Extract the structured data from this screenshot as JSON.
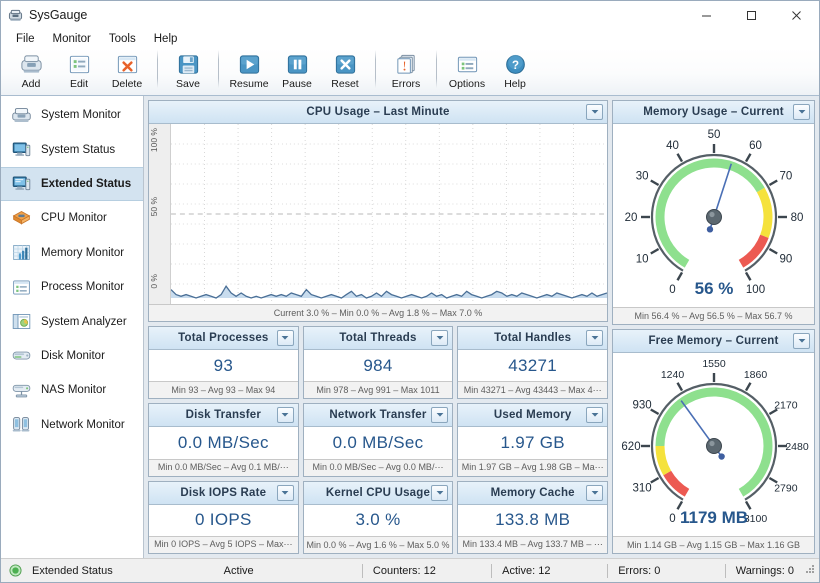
{
  "window": {
    "title": "SysGauge",
    "icon": "sysgauge-icon",
    "controls": {
      "minimize": "–",
      "maximize": "☐",
      "close": "✕"
    }
  },
  "menubar": {
    "items": [
      {
        "label": "File",
        "name": "menu-file"
      },
      {
        "label": "Monitor",
        "name": "menu-monitor"
      },
      {
        "label": "Tools",
        "name": "menu-tools"
      },
      {
        "label": "Help",
        "name": "menu-help"
      }
    ]
  },
  "toolbar": {
    "buttons": [
      {
        "label": "Add",
        "icon": "add-icon"
      },
      {
        "label": "Edit",
        "icon": "edit-icon"
      },
      {
        "label": "Delete",
        "icon": "delete-icon"
      },
      {
        "label": "Save",
        "icon": "save-icon"
      },
      {
        "label": "Resume",
        "icon": "play-icon"
      },
      {
        "label": "Pause",
        "icon": "pause-icon"
      },
      {
        "label": "Reset",
        "icon": "reset-icon"
      },
      {
        "label": "Errors",
        "icon": "errors-icon"
      },
      {
        "label": "Options",
        "icon": "options-icon"
      },
      {
        "label": "Help",
        "icon": "help-icon"
      }
    ]
  },
  "sidebar": {
    "items": [
      {
        "label": "System Monitor",
        "icon": "system-monitor-icon",
        "active": false
      },
      {
        "label": "System Status",
        "icon": "system-status-icon",
        "active": false
      },
      {
        "label": "Extended Status",
        "icon": "extended-status-icon",
        "active": true
      },
      {
        "label": "CPU Monitor",
        "icon": "cpu-monitor-icon",
        "active": false
      },
      {
        "label": "Memory Monitor",
        "icon": "memory-monitor-icon",
        "active": false
      },
      {
        "label": "Process Monitor",
        "icon": "process-monitor-icon",
        "active": false
      },
      {
        "label": "System Analyzer",
        "icon": "system-analyzer-icon",
        "active": false
      },
      {
        "label": "Disk Monitor",
        "icon": "disk-monitor-icon",
        "active": false
      },
      {
        "label": "NAS Monitor",
        "icon": "nas-monitor-icon",
        "active": false
      },
      {
        "label": "Network Monitor",
        "icon": "network-monitor-icon",
        "active": false
      }
    ]
  },
  "chart_data": {
    "type": "area",
    "title": "CPU Usage – Last Minute",
    "xlabel": "",
    "ylabel": "%",
    "ylim": [
      0,
      100
    ],
    "ytick_labels": [
      "100 %",
      "50 %",
      "0 %"
    ],
    "ytick_values": [
      100,
      50,
      0
    ],
    "grid": true,
    "series_color": "#4a6f96",
    "fill_color": "#c8dcee",
    "footer": "Current 3.0 % – Min 0.0 % – Avg 1.8 % – Max 7.0 %",
    "stats": {
      "current": "3.0 %",
      "min": "0.0 %",
      "avg": "1.8 %",
      "max": "7.0 %"
    },
    "values": [
      5,
      2,
      1,
      2,
      1,
      0,
      1,
      2,
      1,
      0,
      2,
      7,
      3,
      1,
      3,
      1,
      0,
      1,
      0,
      1,
      2,
      1,
      2,
      1,
      3,
      2,
      1,
      5,
      2,
      1,
      0,
      1,
      2,
      1,
      0,
      2,
      4,
      1,
      2,
      0,
      1,
      3,
      1,
      4,
      2,
      1,
      0,
      1,
      2,
      1,
      0,
      1,
      3,
      1,
      2,
      0,
      1,
      2,
      1,
      4,
      2,
      1,
      0,
      1,
      2,
      4,
      3,
      1,
      2,
      1,
      3,
      2,
      1,
      0,
      1,
      2,
      1,
      3,
      2,
      1,
      0,
      1,
      2,
      1,
      3,
      1,
      2,
      3
    ]
  },
  "panels": {
    "cpu_chart": {
      "title": "CPU Usage – Last Minute",
      "footer": "Current 3.0 % – Min 0.0 % – Avg 1.8 % – Max 7.0 %"
    },
    "stats": [
      {
        "title": "Total Processes",
        "value": "93",
        "footer": "Min 93 – Avg 93 – Max 94"
      },
      {
        "title": "Total Threads",
        "value": "984",
        "footer": "Min 978 – Avg 991 – Max 1011"
      },
      {
        "title": "Total Handles",
        "value": "43271",
        "footer": "Min 43271 – Avg 43443 – Max 4⋯"
      },
      {
        "title": "Disk Transfer",
        "value": "0.0 MB/Sec",
        "footer": "Min 0.0 MB/Sec – Avg 0.1 MB/⋯"
      },
      {
        "title": "Network Transfer",
        "value": "0.0 MB/Sec",
        "footer": "Min 0.0 MB/Sec – Avg 0.0 MB/⋯"
      },
      {
        "title": "Used Memory",
        "value": "1.97 GB",
        "footer": "Min 1.97 GB – Avg 1.98 GB – Ma⋯"
      },
      {
        "title": "Disk IOPS Rate",
        "value": "0 IOPS",
        "footer": "Min 0 IOPS – Avg 5 IOPS – Max⋯"
      },
      {
        "title": "Kernel CPU Usage",
        "value": "3.0 %",
        "footer": "Min 0.0 % – Avg 1.6 % – Max 5.0 %"
      },
      {
        "title": "Memory Cache",
        "value": "133.8 MB",
        "footer": "Min 133.4 MB – Avg 133.7 MB – ⋯"
      }
    ],
    "gauges": [
      {
        "title": "Memory Usage – Current",
        "reading": "56 %",
        "footer": "Min 56.4 % – Avg 56.5 % – Max 56.7 %",
        "value": 56,
        "min": 0,
        "max": 100,
        "ticks": [
          "0",
          "10",
          "20",
          "30",
          "40",
          "50",
          "60",
          "70",
          "80",
          "90",
          "100"
        ],
        "zones": [
          {
            "from": 0,
            "to": 70,
            "color": "#8ee08e"
          },
          {
            "from": 70,
            "to": 87,
            "color": "#f5e23c"
          },
          {
            "from": 87,
            "to": 100,
            "color": "#ec5a52"
          }
        ]
      },
      {
        "title": "Free Memory – Current",
        "reading": "1179 MB",
        "footer": "Min 1.14 GB – Avg 1.15 GB – Max 1.16 GB",
        "value": 1179,
        "min": 0,
        "max": 3100,
        "ticks": [
          "0",
          "310",
          "620",
          "930",
          "1240",
          "1550",
          "1860",
          "2170",
          "2480",
          "2790",
          "3100"
        ],
        "zones": [
          {
            "from": 0,
            "to": 310,
            "color": "#ec5a52"
          },
          {
            "from": 310,
            "to": 620,
            "color": "#f5e23c"
          },
          {
            "from": 620,
            "to": 3100,
            "color": "#8ee08e"
          }
        ]
      }
    ]
  },
  "statusbar": {
    "led_color": "#4caf50",
    "mode": "Extended Status",
    "state": "Active",
    "counters": "Counters: 12",
    "active": "Active: 12",
    "errors": "Errors: 0",
    "warnings": "Warnings: 0"
  }
}
